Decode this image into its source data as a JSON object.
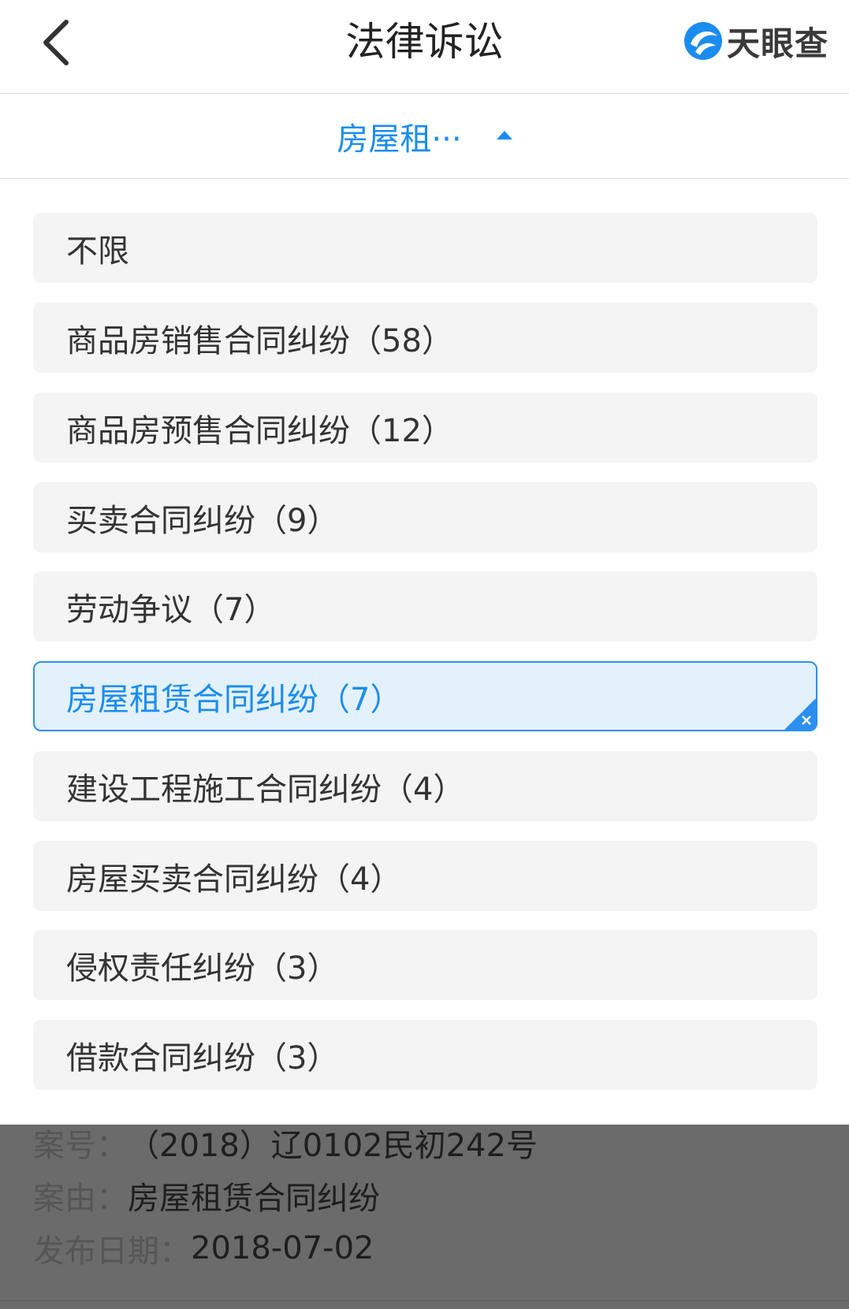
{
  "header": {
    "title": "法律诉讼",
    "brand_name": "天眼查",
    "brand_color": "#1a8cf0",
    "back_icon": "chevron-left-icon"
  },
  "filter": {
    "selected_label": "房屋租···",
    "caret_icon": "caret-up-icon",
    "accent_color": "#1a8cf0"
  },
  "options": [
    {
      "label": "不限",
      "selected": false
    },
    {
      "label": "商品房销售合同纠纷（58）",
      "selected": false
    },
    {
      "label": "商品房预售合同纠纷（12）",
      "selected": false
    },
    {
      "label": "买卖合同纠纷（9）",
      "selected": false
    },
    {
      "label": "劳动争议（7）",
      "selected": false
    },
    {
      "label": "房屋租赁合同纠纷（7）",
      "selected": true
    },
    {
      "label": "建设工程施工合同纠纷（4）",
      "selected": false
    },
    {
      "label": "房屋买卖合同纠纷（4）",
      "selected": false
    },
    {
      "label": "侵权责任纠纷（3）",
      "selected": false
    },
    {
      "label": "借款合同纠纷（3）",
      "selected": false
    }
  ],
  "case_info": {
    "case_no_label": "案号：",
    "case_no": "（2018）辽0102民初242号",
    "cause_label": "案由：",
    "cause": "房屋租赁合同纠纷",
    "date_label": "发布日期：",
    "date": "2018-07-02"
  }
}
